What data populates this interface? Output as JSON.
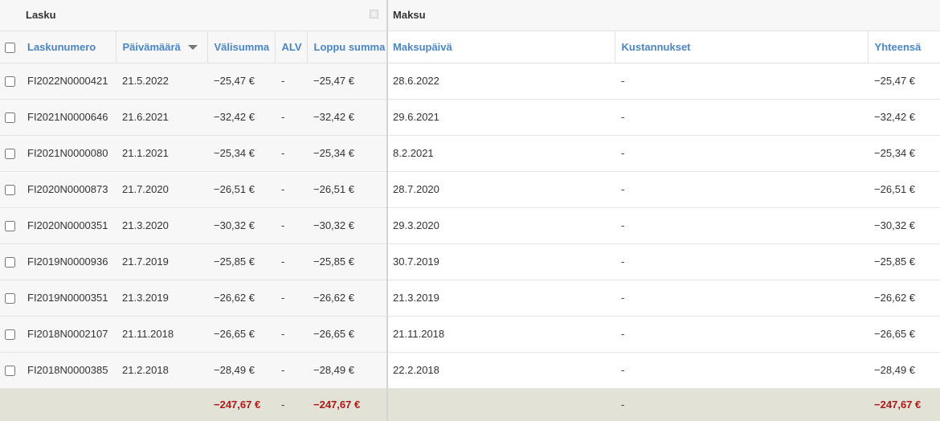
{
  "groups": {
    "lasku": "Lasku",
    "maksu": "Maksu"
  },
  "columns": {
    "laskunumero": "Laskunumero",
    "paivamaara": "Päivämäärä",
    "valisumma": "Välisumma",
    "alv": "ALV",
    "loppusumma": "Loppu summa",
    "maksupaiva": "Maksupäivä",
    "kustannukset": "Kustannukset",
    "yhteensa": "Yhteensä"
  },
  "sort": {
    "column": "paivamaara",
    "direction": "descending",
    "icon": "sort-down-icon"
  },
  "rows": [
    {
      "laskunumero": "FI2022N0000421",
      "paivamaara": "21.5.2022",
      "valisumma": "−25,47 €",
      "alv": "-",
      "loppusumma": "−25,47 €",
      "maksupaiva": "28.6.2022",
      "kustannukset": "-",
      "yhteensa": "−25,47 €"
    },
    {
      "laskunumero": "FI2021N0000646",
      "paivamaara": "21.6.2021",
      "valisumma": "−32,42 €",
      "alv": "-",
      "loppusumma": "−32,42 €",
      "maksupaiva": "29.6.2021",
      "kustannukset": "-",
      "yhteensa": "−32,42 €"
    },
    {
      "laskunumero": "FI2021N0000080",
      "paivamaara": "21.1.2021",
      "valisumma": "−25,34 €",
      "alv": "-",
      "loppusumma": "−25,34 €",
      "maksupaiva": "8.2.2021",
      "kustannukset": "-",
      "yhteensa": "−25,34 €"
    },
    {
      "laskunumero": "FI2020N0000873",
      "paivamaara": "21.7.2020",
      "valisumma": "−26,51 €",
      "alv": "-",
      "loppusumma": "−26,51 €",
      "maksupaiva": "28.7.2020",
      "kustannukset": "-",
      "yhteensa": "−26,51 €"
    },
    {
      "laskunumero": "FI2020N0000351",
      "paivamaara": "21.3.2020",
      "valisumma": "−30,32 €",
      "alv": "-",
      "loppusumma": "−30,32 €",
      "maksupaiva": "29.3.2020",
      "kustannukset": "-",
      "yhteensa": "−30,32 €"
    },
    {
      "laskunumero": "FI2019N0000936",
      "paivamaara": "21.7.2019",
      "valisumma": "−25,85 €",
      "alv": "-",
      "loppusumma": "−25,85 €",
      "maksupaiva": "30.7.2019",
      "kustannukset": "-",
      "yhteensa": "−25,85 €"
    },
    {
      "laskunumero": "FI2019N0000351",
      "paivamaara": "21.3.2019",
      "valisumma": "−26,62 €",
      "alv": "-",
      "loppusumma": "−26,62 €",
      "maksupaiva": "21.3.2019",
      "kustannukset": "-",
      "yhteensa": "−26,62 €"
    },
    {
      "laskunumero": "FI2018N0002107",
      "paivamaara": "21.11.2018",
      "valisumma": "−26,65 €",
      "alv": "-",
      "loppusumma": "−26,65 €",
      "maksupaiva": "21.11.2018",
      "kustannukset": "-",
      "yhteensa": "−26,65 €"
    },
    {
      "laskunumero": "FI2018N0000385",
      "paivamaara": "21.2.2018",
      "valisumma": "−28,49 €",
      "alv": "-",
      "loppusumma": "−28,49 €",
      "maksupaiva": "22.2.2018",
      "kustannukset": "-",
      "yhteensa": "−28,49 €"
    }
  ],
  "totals": {
    "valisumma": "−247,67 €",
    "alv": "-",
    "loppusumma": "−247,67 €",
    "kustannukset": "-",
    "yhteensa": "−247,67 €"
  },
  "colors": {
    "negative": "#b01818",
    "header_link": "#4a86c5",
    "total_bg": "#e2e2d6"
  }
}
